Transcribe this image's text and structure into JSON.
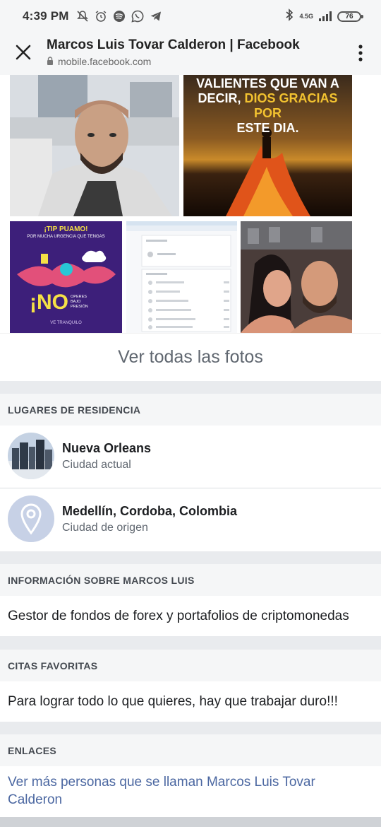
{
  "status_bar": {
    "time": "4:39 PM",
    "network": "4.5G",
    "battery": "76"
  },
  "browser": {
    "title": "Marcos Luis Tovar Calderon | Facebook",
    "url": "mobile.facebook.com"
  },
  "photos": {
    "quote_text_line1": "VALIENTES QUE VAN A",
    "quote_text_line2a": "DECIR,",
    "quote_text_line2b": "DIOS GRACIAS POR",
    "quote_text_line3": "ESTE DIA.",
    "tip_title": "¡TIP PUAMO!",
    "tip_subtitle": "POR MUCHA URGENCIA QUE TENGAS",
    "tip_no": "¡NO",
    "tip_side": "OPERES BAJO PRESIÓN",
    "tip_footer": "VE TRANQUILO",
    "see_all": "Ver todas las fotos"
  },
  "residence": {
    "heading": "LUGARES DE RESIDENCIA",
    "places": [
      {
        "name": "Nueva Orleans",
        "sub": "Ciudad actual"
      },
      {
        "name": "Medellín, Cordoba, Colombia",
        "sub": "Ciudad de origen"
      }
    ]
  },
  "about": {
    "heading": "INFORMACIÓN SOBRE MARCOS LUIS",
    "text": "Gestor de fondos de forex y portafolios de criptomonedas"
  },
  "quotes": {
    "heading": "CITAS FAVORITAS",
    "text": "Para lograr todo lo que quieres, hay que trabajar duro!!!"
  },
  "links": {
    "heading": "ENLACES",
    "text": "Ver más personas que se llaman Marcos Luis Tovar Calderon"
  },
  "colors": {
    "link": "#4b67a1",
    "section_bg": "#f5f6f7",
    "gap_bg": "#e9ebee"
  }
}
